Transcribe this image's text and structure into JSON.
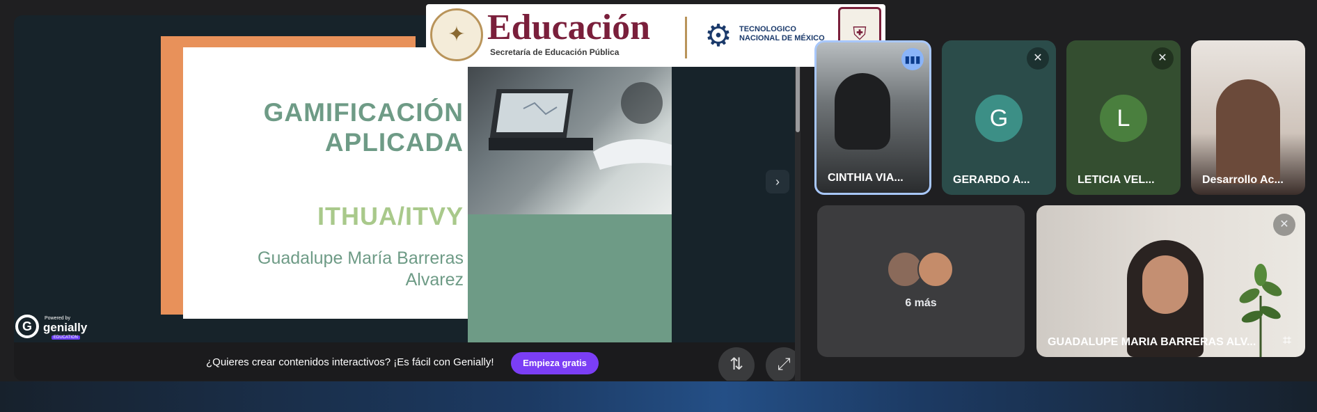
{
  "header": {
    "seal_icon": "mexico-seal-icon",
    "brand_word": "Educación",
    "brand_subtitle": "Secretaría de Educación Pública",
    "tec_name": "TECNOLOGICO NACIONAL DE MÉXICO",
    "shield_icon": "institution-shield-icon"
  },
  "presentation": {
    "slide_title": "GAMIFICACIÓN APLICADA",
    "slide_subtitle": "ITHUA/ITVY",
    "slide_author": "Guadalupe María Barreras Alvarez",
    "genially_powered": "Powered by",
    "genially_name": "genially",
    "genially_edu": "EDUCATION",
    "next_icon": "›",
    "banner_text": "¿Quieres crear contenidos interactivos? ¡Es fácil con Genially!",
    "banner_cta": "Empieza gratis",
    "swap_icon": "⇅",
    "expand_icon": "⤢"
  },
  "participants": [
    {
      "name": "CINTHIA VIA...",
      "speaking": true
    },
    {
      "name": "GERARDO A...",
      "initial": "G",
      "avatar_color": "#3c8f86",
      "muted": true
    },
    {
      "name": "LETICIA VEL...",
      "initial": "L",
      "avatar_color": "#4a7f3e",
      "muted": true
    },
    {
      "name": "Desarrollo Ac..."
    },
    {
      "name": "GUADALUPE MARIA BARRERAS ALV...",
      "muted": true
    }
  ],
  "more_tile": {
    "label": "6 más"
  },
  "icons": {
    "mute": "🎙",
    "speaking": "▮▮▮",
    "crop": "⌗"
  },
  "colors": {
    "speaking_border": "#a8c7fa",
    "genially_cta": "#7b3ef5",
    "slide_green": "#6e9b86",
    "slide_orange": "#e8915a"
  }
}
